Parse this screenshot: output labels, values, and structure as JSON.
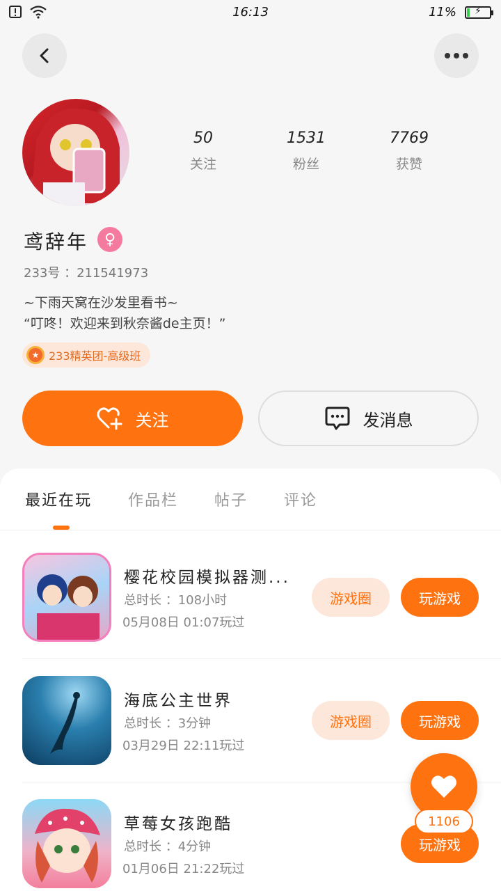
{
  "status_bar": {
    "time": "16:13",
    "battery": "11%",
    "battery_level": 0.11
  },
  "header": {
    "back_icon": "chevron-left-icon",
    "more_icon": "more-horizontal-icon"
  },
  "profile": {
    "stats": [
      {
        "value": "50",
        "label": "关注"
      },
      {
        "value": "1531",
        "label": "粉丝"
      },
      {
        "value": "7769",
        "label": "获赞"
      }
    ],
    "username": "鸢辞年",
    "gender_symbol": "♀",
    "uid": "233号 ：211541973",
    "bio_line1": "~下雨天窝在沙发里看书~",
    "bio_line2": "“叮咚！欢迎来到秋奈酱de主页！”",
    "badge": "233精英团-高级班"
  },
  "actions": {
    "follow": "关注",
    "message": "发消息"
  },
  "tabs": [
    "最近在玩",
    "作品栏",
    "帖子",
    "评论"
  ],
  "games": [
    {
      "name": "樱花校园模拟器测...",
      "duration": "总时长 ：108小时",
      "last_played": "05月08日 01:07玩过",
      "circle_label": "游戏圈",
      "play_label": "玩游戏"
    },
    {
      "name": "海底公主世界",
      "duration": "总时长 ：3分钟",
      "last_played": "03月29日 22:11玩过",
      "circle_label": "游戏圈",
      "play_label": "玩游戏"
    },
    {
      "name": "草莓女孩跑酷",
      "duration": "总时长 ：4分钟",
      "last_played": "01月06日 21:22玩过",
      "play_label": "玩游戏"
    }
  ],
  "fab": {
    "count": "1106"
  },
  "colors": {
    "accent": "#ff7210",
    "tag_bg": "#fde7da",
    "gender": "#f47aa0"
  }
}
